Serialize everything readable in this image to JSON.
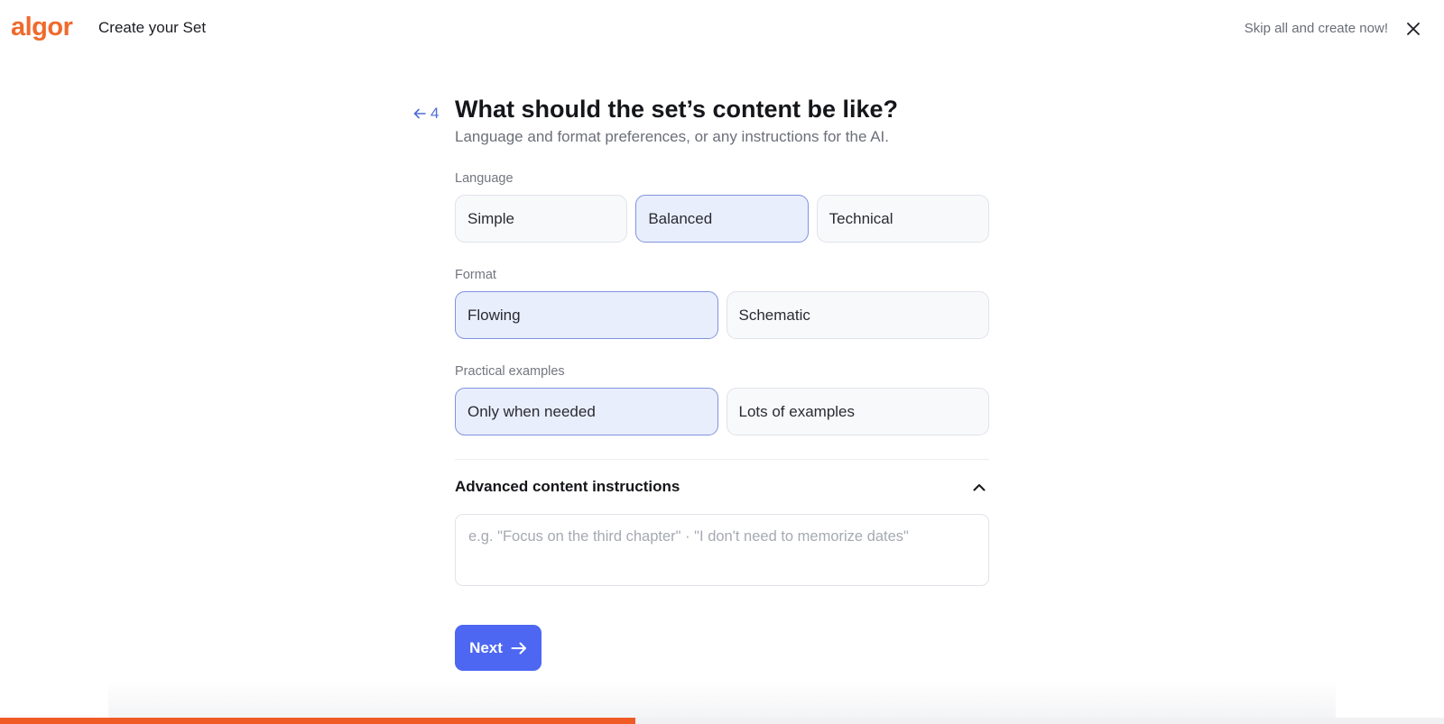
{
  "header": {
    "logo": "algor",
    "title": "Create your Set",
    "skip_label": "Skip all and create now!",
    "close_icon": "close-icon"
  },
  "step": {
    "back_icon": "arrow-left-icon",
    "number": "4",
    "title": "What should the set’s content be like?",
    "subtitle": "Language and format preferences, or any instructions for the AI."
  },
  "sections": {
    "language": {
      "label": "Language",
      "options": [
        "Simple",
        "Balanced",
        "Technical"
      ],
      "selected": "Balanced"
    },
    "format": {
      "label": "Format",
      "options": [
        "Flowing",
        "Schematic"
      ],
      "selected": "Flowing"
    },
    "examples": {
      "label": "Practical examples",
      "options": [
        "Only when needed",
        "Lots of examples"
      ],
      "selected": "Only when needed"
    }
  },
  "advanced": {
    "label": "Advanced content instructions",
    "toggle_icon": "chevron-up-icon",
    "placeholder": "e.g. \"Focus on the third chapter\" · \"I don't need to memorize dates\"",
    "value": ""
  },
  "next": {
    "label": "Next",
    "icon": "arrow-right-icon"
  },
  "progress": {
    "fraction": 0.44
  },
  "colors": {
    "brand": "#ef6a2c",
    "accent": "#4d67f2",
    "selected_bg": "#e9eefd",
    "progress": "#ef5a25"
  }
}
